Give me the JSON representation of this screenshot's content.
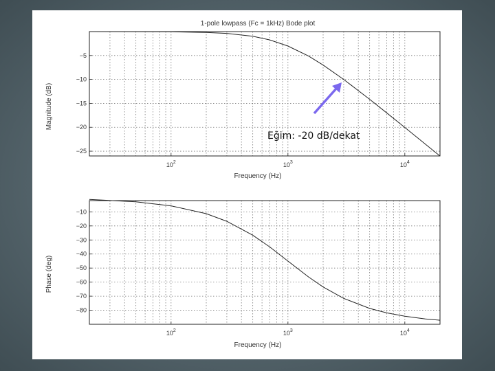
{
  "colors": {
    "frame": "#55656c",
    "plot_line": "#222222",
    "grid": "#777777",
    "arrow": "#7b68ee"
  },
  "annotation": {
    "text": "Eğim: -20 dB/dekat"
  },
  "chart_data": [
    {
      "type": "line",
      "title": "1-pole lowpass (Fc = 1kHz) Bode plot",
      "xlabel": "Frequency (Hz)",
      "ylabel": "Magnitude (dB)",
      "xscale": "log",
      "xlim": [
        20,
        20000
      ],
      "ylim": [
        -26,
        0
      ],
      "xticks": [
        100,
        1000,
        10000
      ],
      "xtick_labels": [
        {
          "base": "10",
          "exp": "2"
        },
        {
          "base": "10",
          "exp": "3"
        },
        {
          "base": "10",
          "exp": "4"
        }
      ],
      "yticks": [
        -5,
        -10,
        -15,
        -20,
        -25
      ],
      "ytick_labels": [
        "−5",
        "−10",
        "−15",
        "−20",
        "−25"
      ],
      "grid": true,
      "series": [
        {
          "x": [
            20,
            50,
            100,
            200,
            300,
            500,
            700,
            1000,
            1500,
            2000,
            3000,
            5000,
            7000,
            10000,
            15000,
            20000
          ],
          "y": [
            -0.002,
            -0.011,
            -0.043,
            -0.17,
            -0.37,
            -0.97,
            -1.74,
            -3.01,
            -5.12,
            -6.99,
            -10.0,
            -14.15,
            -16.99,
            -20.04,
            -23.54,
            -26.02
          ]
        }
      ]
    },
    {
      "type": "line",
      "title": "",
      "xlabel": "Frequency (Hz)",
      "ylabel": "Phase (deg)",
      "xscale": "log",
      "xlim": [
        20,
        20000
      ],
      "ylim": [
        -90,
        -2
      ],
      "xticks": [
        100,
        1000,
        10000
      ],
      "xtick_labels": [
        {
          "base": "10",
          "exp": "2"
        },
        {
          "base": "10",
          "exp": "3"
        },
        {
          "base": "10",
          "exp": "4"
        }
      ],
      "yticks": [
        -10,
        -20,
        -30,
        -40,
        -50,
        -60,
        -70,
        -80
      ],
      "ytick_labels": [
        "−10",
        "−20",
        "−30",
        "−40",
        "−50",
        "−60",
        "−70",
        "−80"
      ],
      "grid": true,
      "series": [
        {
          "x": [
            20,
            50,
            100,
            200,
            300,
            500,
            700,
            1000,
            1500,
            2000,
            3000,
            5000,
            7000,
            10000,
            15000,
            20000
          ],
          "y": [
            -1.15,
            -2.86,
            -5.71,
            -11.31,
            -16.7,
            -26.57,
            -34.99,
            -45.0,
            -56.31,
            -63.43,
            -71.57,
            -78.69,
            -81.87,
            -84.29,
            -86.19,
            -87.14
          ]
        }
      ]
    }
  ]
}
